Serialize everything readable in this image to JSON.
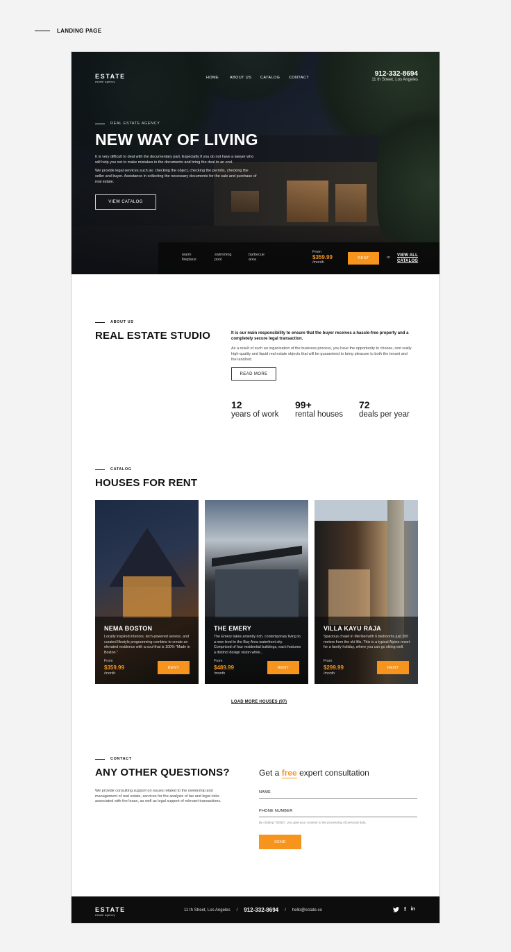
{
  "page_label": "LANDING PAGE",
  "brand": {
    "name": "ESTATE",
    "tagline": "estate agency"
  },
  "nav": [
    "HOME",
    "ABOUT US",
    "CATALOG",
    "CONTACT"
  ],
  "header": {
    "phone": "912-332-8694",
    "address": "11 th Street, Los Angeles"
  },
  "hero": {
    "eyebrow": "REAL ESTATE AGENCY",
    "title": "NEW WAY OF LIVING",
    "p1": "It is very difficult to deal with the documentary part. Especially if you do not have a lawyer who will help you not to make mistakes in the documents and bring the deal to an end.",
    "p2": "We provide legal services such as: checking the object, checking the permits, checking the seller and buyer. Assistance in collecting the necessary documents for the sale and purchase of real estate.",
    "button": "VIEW CATALOG",
    "features": [
      "warm fireplace",
      "swimming pool",
      "barbecue area"
    ],
    "price_from": "From",
    "price": "$359.99",
    "per": "/month",
    "rent": "RENT",
    "or": "or",
    "view_all_1": "VIEW ALL",
    "view_all_2": "CATALOG"
  },
  "about": {
    "eyebrow": "ABOUT US",
    "title": "REAL ESTATE STUDIO",
    "strong": "It is our main responsibility to ensure that the buyer receives a hassle-free property and a completely secure legal transaction.",
    "text": "As a result of such an organization of the business process, you have the opportunity to choose, rent really high-quality and liquid real estate objects that will be guaranteed to bring pleasure to both the tenant and the landlord.",
    "button": "READ MORE",
    "stats": [
      {
        "num": "12",
        "label": "years of work"
      },
      {
        "num": "99+",
        "label": "rental houses"
      },
      {
        "num": "72",
        "label": "deals per year"
      }
    ]
  },
  "catalog": {
    "eyebrow": "CATALOG",
    "title": "HOUSES FOR RENT",
    "cards": [
      {
        "title": "NEMA BOSTON",
        "desc": "Locally inspired interiors, tech-powered service, and curated lifestyle programming combine to create an elevated residence with a soul that is 100% \"Made in Boston.\"",
        "from": "From",
        "price": "$359.99",
        "per": "/month",
        "button": "RENT"
      },
      {
        "title": "THE EMERY",
        "desc": "The Emery takes amenity rich, contemporary living to a new level in the Bay Area waterfront city. Comprised of four residential buildings, each features a distinct design vision while...",
        "from": "From",
        "price": "$489.99",
        "per": "/month",
        "button": "RENT"
      },
      {
        "title": "VILLA KAYU RAJA",
        "desc": "Spacious chalet in Meribel with 6 bedrooms just 200 meters from the ski lifts. This is a typical Alpine resort for a family holiday, where you can go skiing well.",
        "from": "From",
        "price": "$299.99",
        "per": "/month",
        "button": "RENT"
      }
    ],
    "load_more": "LOAD MORE HOUSES (97)"
  },
  "contact": {
    "eyebrow": "CONTACT",
    "title": "ANY OTHER QUESTIONS?",
    "text": "We provide consulting support on issues related to the ownership and management of real estate, services for the analysis of tax and legal risks associated with the lease, as well as legal support of relevant transactions.",
    "consult_pre": "Get a",
    "consult_free": "free",
    "consult_post": "expert consultation",
    "name_label": "NAME",
    "phone_label": "PHONE NUMBER",
    "consent": "By clicking \"SEND\", you give your consent to the processing of personal data.",
    "send": "SEND"
  },
  "footer": {
    "address": "11 th Street, Los Angeles",
    "sep": "/",
    "phone": "912-332-8694",
    "email": "hello@estate.co",
    "social": [
      "twitter-icon",
      "facebook-icon",
      "linkedin-icon"
    ]
  },
  "colors": {
    "accent": "#f7941d",
    "dark": "#0d0d0d"
  }
}
